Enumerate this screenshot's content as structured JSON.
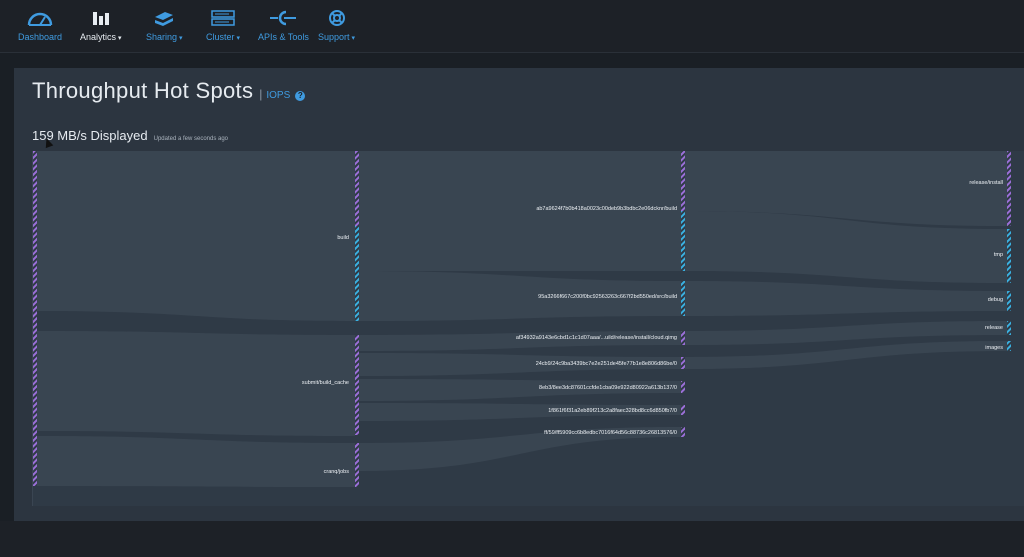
{
  "nav": {
    "items": [
      {
        "label": "Dashboard",
        "icon": "gauge-icon"
      },
      {
        "label": "Analytics",
        "icon": "bar-chart-icon",
        "caret": "▾"
      },
      {
        "label": "Sharing",
        "icon": "share-icon",
        "caret": "▾"
      },
      {
        "label": "Cluster",
        "icon": "cluster-icon",
        "caret": "▾"
      },
      {
        "label": "APIs & Tools",
        "icon": "plug-icon"
      },
      {
        "label": "Support",
        "icon": "lifebuoy-icon",
        "caret": "▾"
      }
    ]
  },
  "page": {
    "title": "Throughput Hot Spots",
    "separator": "|",
    "iops_link": "IOPS",
    "help": "?",
    "displayed": "159 MB/s Displayed",
    "updated": "Updated a few seconds ago"
  },
  "colors": {
    "accent": "#3f9be0",
    "purple": "#9b6fd8",
    "cyan": "#3ab0e0",
    "flow": "#3d4956"
  },
  "sankey": {
    "col1": [
      {
        "label": "build"
      },
      {
        "label": "submit/build_cache"
      },
      {
        "label": "cranq/jobs"
      }
    ],
    "col2": [
      {
        "label": "ab7a9624f7b0b418a0023c00deb9b3bdbc2e06dcknr/build"
      },
      {
        "label": "95a3266f667c200f0bc92563263c667f2bd550ed/src/build"
      },
      {
        "label": "af34932a9143e6cbd1c1c1d07aaa/...uild/release/install/cloud.qimg"
      },
      {
        "label": "24cb9/24c9ba3439bc7e2e251de45fe77b1e8e806d86be/0"
      },
      {
        "label": "8eb3/8ee3dc87601ccfde1cba09e922d80922a613b137/0"
      },
      {
        "label": "1f861f6f31a2eb89f213c2a8faec328bd8cc6d850fb7/0"
      },
      {
        "label": "ff/59/ff5909cc6b8edbc7016f64d56c88736c26813576/0"
      }
    ],
    "col3": [
      {
        "label": "release/install"
      },
      {
        "label": "tmp"
      },
      {
        "label": "debug"
      },
      {
        "label": "release"
      },
      {
        "label": "images"
      }
    ]
  }
}
